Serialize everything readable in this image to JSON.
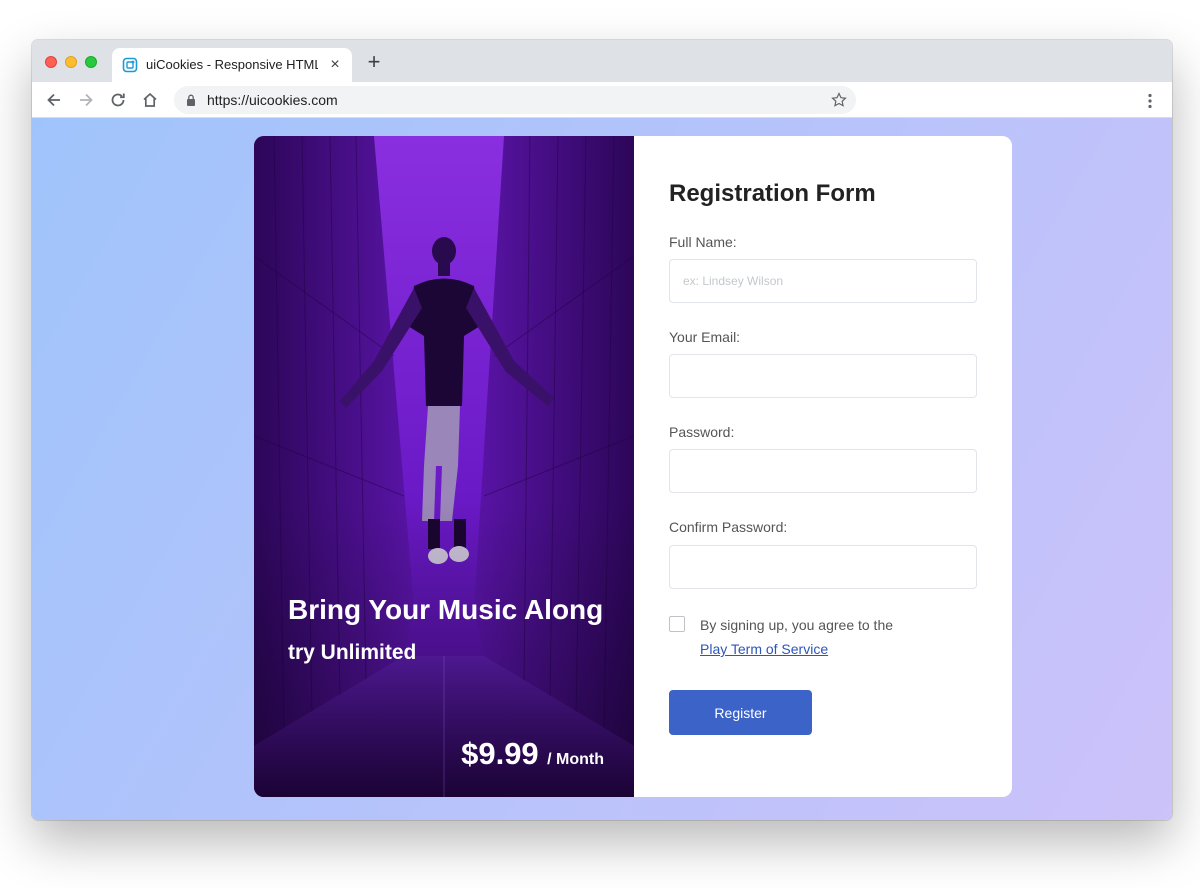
{
  "browser": {
    "tab_title": "uiCookies - Responsive HTML",
    "tab_close": "×",
    "new_tab": "+",
    "url": "https://uicookies.com"
  },
  "hero": {
    "title": "Bring Your Music Along",
    "subtitle": "try Unlimited",
    "price": "$9.99",
    "period": "/ Month"
  },
  "form": {
    "title": "Registration Form",
    "full_name_label": "Full Name:",
    "full_name_placeholder": "ex: Lindsey Wilson",
    "email_label": "Your Email:",
    "password_label": "Password:",
    "confirm_password_label": "Confirm Password:",
    "terms_text": "By signing up, you agree to the",
    "terms_link": "Play Term of Service",
    "register_label": "Register"
  },
  "colors": {
    "accent": "#3b63c8",
    "hero_purple": "#5b12ad",
    "link": "#2c56b8"
  }
}
